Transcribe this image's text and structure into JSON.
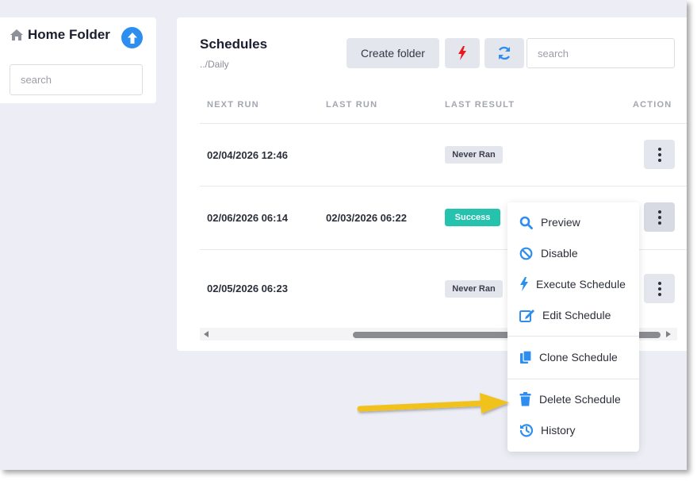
{
  "sidebar": {
    "title": "Home Folder",
    "search_placeholder": "search"
  },
  "main": {
    "title": "Schedules",
    "path": "../Daily",
    "create_folder_label": "Create folder",
    "search_placeholder": "search",
    "columns": [
      "NEXT RUN",
      "LAST RUN",
      "LAST RESULT",
      "ACTION"
    ],
    "rows": [
      {
        "next_run": "02/04/2026 12:46",
        "last_run": "",
        "last_result": "Never Ran"
      },
      {
        "next_run": "02/06/2026 06:14",
        "last_run": "02/03/2026 06:22",
        "last_result": "Success"
      },
      {
        "next_run": "02/05/2026 06:23",
        "last_run": "",
        "last_result": "Never Ran"
      }
    ]
  },
  "menu": {
    "items": [
      {
        "label": "Preview",
        "icon": "search-icon"
      },
      {
        "label": "Disable",
        "icon": "ban-icon"
      },
      {
        "label": "Execute Schedule",
        "icon": "bolt-icon"
      },
      {
        "label": "Edit Schedule",
        "icon": "edit-icon"
      },
      {
        "label": "Clone Schedule",
        "icon": "copy-icon"
      },
      {
        "label": "Delete Schedule",
        "icon": "trash-icon"
      },
      {
        "label": "History",
        "icon": "history-icon"
      }
    ]
  },
  "colors": {
    "accent": "#2d8ef0",
    "success": "#25c2ae",
    "execute_red": "#e8191f",
    "annotation_arrow": "#f2c21a"
  }
}
